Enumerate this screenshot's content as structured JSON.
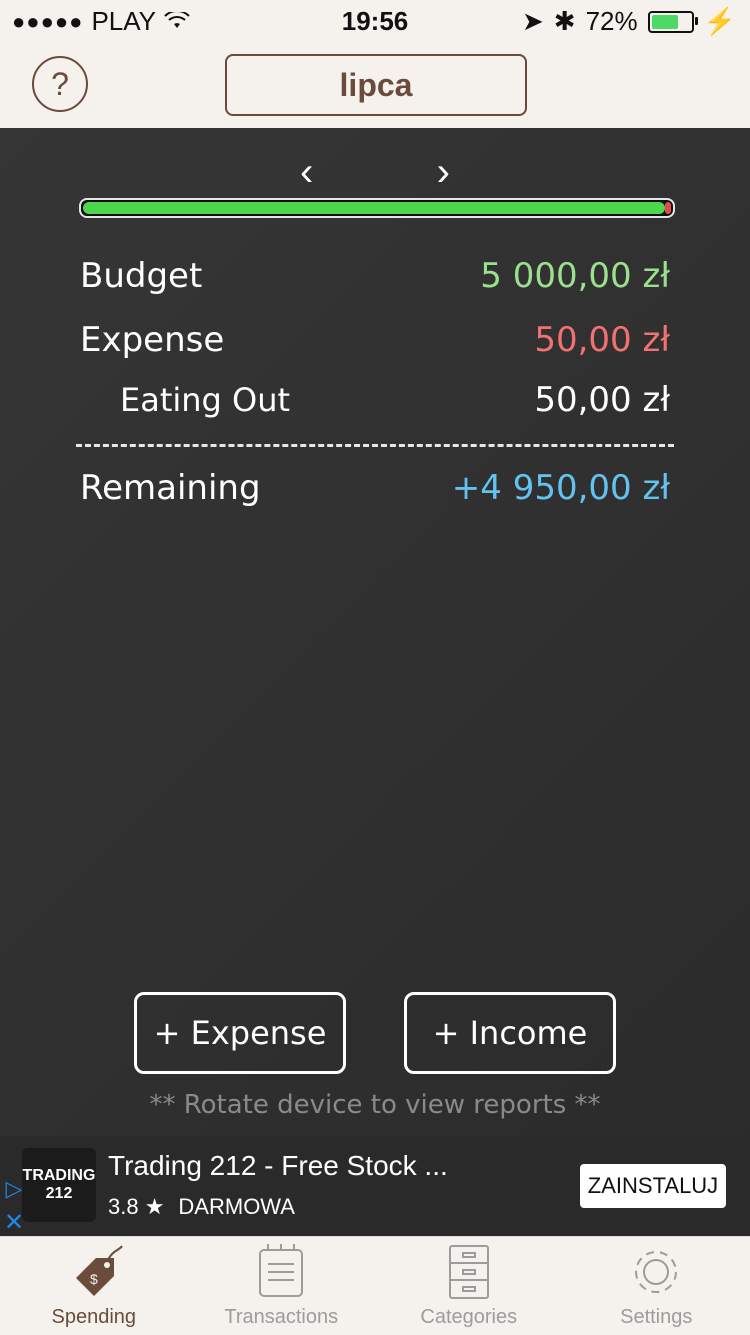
{
  "status": {
    "carrier": "PLAY",
    "time": "19:56",
    "battery_percent": "72%",
    "battery_level": 0.72
  },
  "header": {
    "month": "lipca"
  },
  "summary": {
    "budget": {
      "label": "Budget",
      "value": "5 000,00 zł",
      "color": "#9be08e"
    },
    "expense": {
      "label": "Expense",
      "value": "50,00 zł",
      "color": "#f27272"
    },
    "eating_out": {
      "label": "Eating Out",
      "value": "50,00 zł",
      "color": "#ffffff"
    },
    "remaining": {
      "label": "Remaining",
      "value": "+4 950,00 zł",
      "color": "#63c3f0"
    },
    "progress_fraction": 0.99
  },
  "actions": {
    "expense": "+ Expense",
    "income": "+ Income"
  },
  "hint": "** Rotate device to view reports **",
  "ad": {
    "logo_line1": "TRADING",
    "logo_line2": "212",
    "title": "Trading 212 - Free Stock ...",
    "rating": "3.8 ★",
    "price": "DARMOWA",
    "install": "ZAINSTALUJ"
  },
  "tabs": {
    "spending": "Spending",
    "transactions": "Transactions",
    "categories": "Categories",
    "settings": "Settings"
  }
}
